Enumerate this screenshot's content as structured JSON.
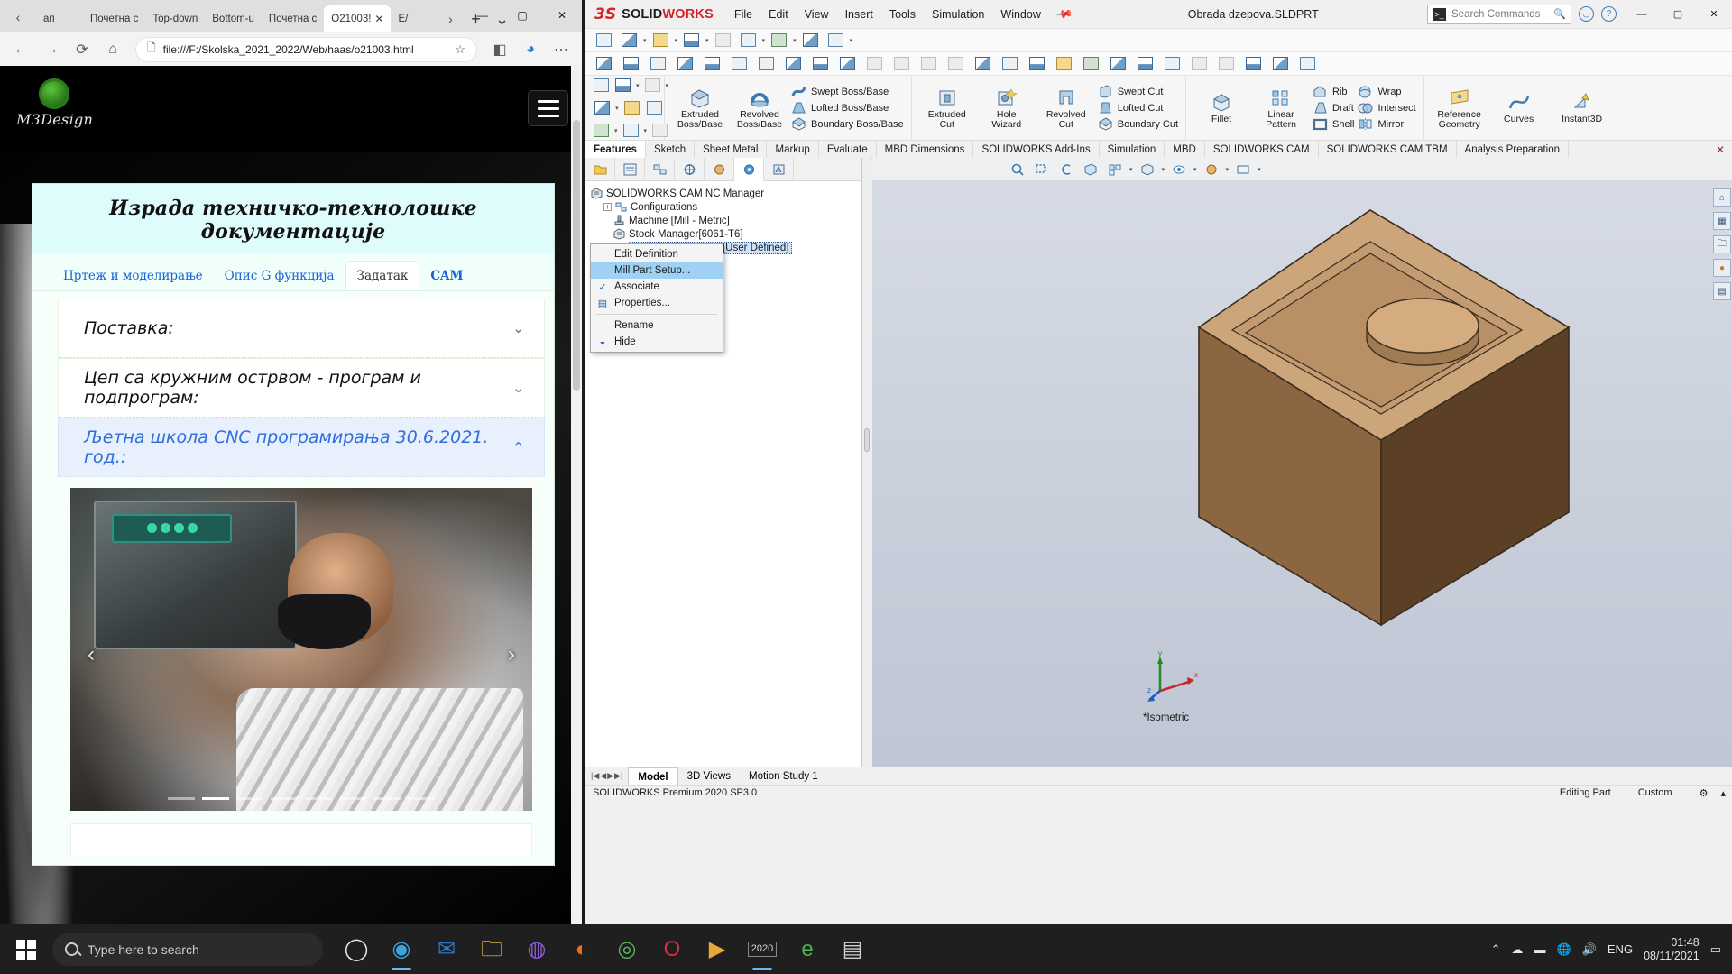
{
  "browser": {
    "tabs": [
      {
        "label": "ап",
        "active": false
      },
      {
        "label": "Почетна с",
        "active": false
      },
      {
        "label": "Top-down",
        "active": false
      },
      {
        "label": "Bottom-u",
        "active": false
      },
      {
        "label": "Почетна с",
        "active": false
      },
      {
        "label": "O21003!",
        "active": true
      },
      {
        "label": "Е/",
        "active": false
      }
    ],
    "new_tab_label": "+",
    "tab_list_label": "⌄",
    "nav": {
      "back": "←",
      "forward": "→",
      "reload": "⟳",
      "home": "⌂"
    },
    "address": "file:///F:/Skolska_2021_2022/Web/haas/o21003.html",
    "favorite_label": "☆",
    "window_controls": {
      "minimize": "—",
      "maximize": "▢",
      "close": "✕"
    }
  },
  "webpage": {
    "logo_text": "M3Design",
    "menu_button": "hamburger-menu",
    "title": "Израда техничко-технолошке документације",
    "tabs": [
      {
        "label": "Цртеж и моделирање",
        "selected": false,
        "bold": false
      },
      {
        "label": "Опис G функција",
        "selected": false,
        "bold": false
      },
      {
        "label": "Задатак",
        "selected": true,
        "bold": false
      },
      {
        "label": "CAM",
        "selected": false,
        "bold": true
      }
    ],
    "accordions": [
      {
        "label": "Поставка:",
        "expanded": false,
        "chevron": "⌄"
      },
      {
        "label": "Цеп са кружним острвом - програм и подпрограм:",
        "expanded": false,
        "chevron": "⌄"
      },
      {
        "label": "Љетна школа CNC програмирања 30.6.2021. год.:",
        "expanded": true,
        "chevron": "⌃"
      }
    ],
    "carousel": {
      "prev": "‹",
      "next": "›",
      "dot_count": 8,
      "active_dot": 1
    }
  },
  "solidworks": {
    "brand_mark": "3S",
    "brand_bold": "SOLID",
    "brand_light": "WORKS",
    "menus": [
      "File",
      "Edit",
      "View",
      "Insert",
      "Tools",
      "Simulation",
      "Window"
    ],
    "pin_icon": "pin-icon",
    "document_title": "Obrada dzepova.SLDPRT",
    "search_placeholder": "Search Commands",
    "search_icon": "search-icon",
    "title_icons": [
      "user-icon",
      "help-icon"
    ],
    "window_controls": {
      "minimize": "—",
      "maximize": "▢",
      "close": "✕"
    },
    "ribbon": {
      "groups": [
        {
          "name": "boss-base",
          "big": [
            {
              "label": "Extruded\nBoss/Base",
              "icon": "extruded-boss-icon"
            },
            {
              "label": "Revolved\nBoss/Base",
              "icon": "revolved-boss-icon"
            }
          ],
          "small": [
            {
              "label": "Swept Boss/Base",
              "icon": "swept-boss-icon"
            },
            {
              "label": "Lofted Boss/Base",
              "icon": "lofted-boss-icon"
            },
            {
              "label": "Boundary Boss/Base",
              "icon": "boundary-boss-icon"
            }
          ]
        },
        {
          "name": "cut",
          "big": [
            {
              "label": "Extruded\nCut",
              "icon": "extruded-cut-icon"
            },
            {
              "label": "Hole\nWizard",
              "icon": "hole-wizard-icon"
            },
            {
              "label": "Revolved\nCut",
              "icon": "revolved-cut-icon"
            }
          ],
          "small": [
            {
              "label": "Swept Cut",
              "icon": "swept-cut-icon"
            },
            {
              "label": "Lofted Cut",
              "icon": "lofted-cut-icon"
            },
            {
              "label": "Boundary Cut",
              "icon": "boundary-cut-icon"
            }
          ]
        },
        {
          "name": "features",
          "big": [
            {
              "label": "Fillet",
              "icon": "fillet-icon"
            },
            {
              "label": "Linear\nPattern",
              "icon": "linear-pattern-icon"
            }
          ],
          "small": [
            {
              "label": "Rib",
              "icon": "rib-icon"
            },
            {
              "label": "Draft",
              "icon": "draft-icon"
            },
            {
              "label": "Shell",
              "icon": "shell-icon"
            },
            {
              "label": "Wrap",
              "icon": "wrap-icon"
            },
            {
              "label": "Intersect",
              "icon": "intersect-icon"
            },
            {
              "label": "Mirror",
              "icon": "mirror-icon"
            }
          ]
        },
        {
          "name": "reference",
          "big": [
            {
              "label": "Reference\nGeometry",
              "icon": "reference-geometry-icon"
            },
            {
              "label": "Curves",
              "icon": "curves-icon"
            },
            {
              "label": "Instant3D",
              "icon": "instant3d-icon"
            }
          ],
          "small": []
        }
      ],
      "tabs": [
        {
          "label": "Features",
          "selected": true
        },
        {
          "label": "Sketch",
          "selected": false
        },
        {
          "label": "Sheet Metal",
          "selected": false
        },
        {
          "label": "Markup",
          "selected": false
        },
        {
          "label": "Evaluate",
          "selected": false
        },
        {
          "label": "MBD Dimensions",
          "selected": false
        },
        {
          "label": "SOLIDWORKS Add-Ins",
          "selected": false
        },
        {
          "label": "Simulation",
          "selected": false
        },
        {
          "label": "MBD",
          "selected": false
        },
        {
          "label": "SOLIDWORKS CAM",
          "selected": false
        },
        {
          "label": "SOLIDWORKS CAM TBM",
          "selected": false
        },
        {
          "label": "Analysis Preparation",
          "selected": false
        }
      ],
      "tabs_close": "✕"
    },
    "tree": {
      "tab_icons": [
        "feature-manager-icon",
        "property-manager-icon",
        "configuration-manager-icon",
        "dimxpert-manager-icon",
        "display-manager-icon",
        "cam-feature-tree-icon",
        "cam-operation-tree-icon"
      ],
      "root": "SOLIDWORKS CAM NC Manager",
      "items": [
        {
          "label": "Configurations",
          "icon": "configurations-icon",
          "expander": "+"
        },
        {
          "label": "Machine [Mill - Metric]",
          "icon": "machine-icon",
          "expander": ""
        },
        {
          "label": "Stock Manager[6061-T6]",
          "icon": "stock-manager-icon",
          "expander": ""
        },
        {
          "label": "Coordinate System [User Defined]",
          "icon": "coordinate-system-icon",
          "expander": "",
          "selected": true
        }
      ]
    },
    "context_menu": [
      {
        "label": "Edit Definition",
        "icon": "",
        "highlight": false,
        "checked": false
      },
      {
        "label": "Mill Part Setup...",
        "icon": "",
        "highlight": true,
        "checked": false
      },
      {
        "label": "Associate",
        "icon": "check-icon",
        "highlight": false,
        "checked": true
      },
      {
        "label": "Properties...",
        "icon": "properties-icon",
        "highlight": false,
        "checked": false
      },
      {
        "separator": true
      },
      {
        "label": "Rename",
        "icon": "",
        "highlight": false,
        "checked": false
      },
      {
        "label": "Hide",
        "icon": "hide-icon",
        "highlight": false,
        "checked": false
      }
    ],
    "viewport": {
      "view_label": "*Isometric",
      "triad_labels": {
        "x": "x",
        "y": "y",
        "z": "z"
      },
      "right_rail_icons": [
        "home-view-icon",
        "view-orientation-icon",
        "appearances-icon",
        "scenes-icon",
        "display-states-icon"
      ]
    },
    "model_tabs": [
      {
        "label": "Model",
        "selected": true
      },
      {
        "label": "3D Views",
        "selected": false
      },
      {
        "label": "Motion Study 1",
        "selected": false
      }
    ],
    "status": {
      "version": "SOLIDWORKS Premium 2020 SP3.0",
      "state": "Editing Part",
      "units": "Custom"
    }
  },
  "taskbar": {
    "start_icon": "windows-start-icon",
    "search_placeholder": "Type here to search",
    "search_icon": "search-icon",
    "items": [
      {
        "name": "task-view-icon",
        "glyph": "◯"
      },
      {
        "name": "edge-icon",
        "glyph": "◉",
        "active": true
      },
      {
        "name": "mail-icon",
        "glyph": "✉"
      },
      {
        "name": "file-explorer-icon",
        "glyph": "🗀"
      },
      {
        "name": "viber-icon",
        "glyph": "◍"
      },
      {
        "name": "firefox-icon",
        "glyph": "◐"
      },
      {
        "name": "chrome-icon",
        "glyph": "◎"
      },
      {
        "name": "opera-icon",
        "glyph": "O"
      },
      {
        "name": "media-player-icon",
        "glyph": "▶"
      },
      {
        "name": "solidworks-2020-icon",
        "glyph": "2020"
      },
      {
        "name": "edrawings-icon",
        "glyph": "e"
      },
      {
        "name": "document-icon",
        "glyph": "▤"
      }
    ],
    "tray": {
      "chevron": "⌃",
      "icons": [
        "onedrive-icon",
        "battery-icon",
        "network-icon",
        "volume-icon"
      ],
      "language": "ENG",
      "time": "01:48",
      "date": "08/11/2021",
      "notifications": "▭"
    }
  },
  "colors": {
    "sw_red": "#d61f26",
    "accent_blue": "#2f6fdc",
    "menu_highlight": "#9fd1f5",
    "tree_selection": "#cfe4fb"
  }
}
